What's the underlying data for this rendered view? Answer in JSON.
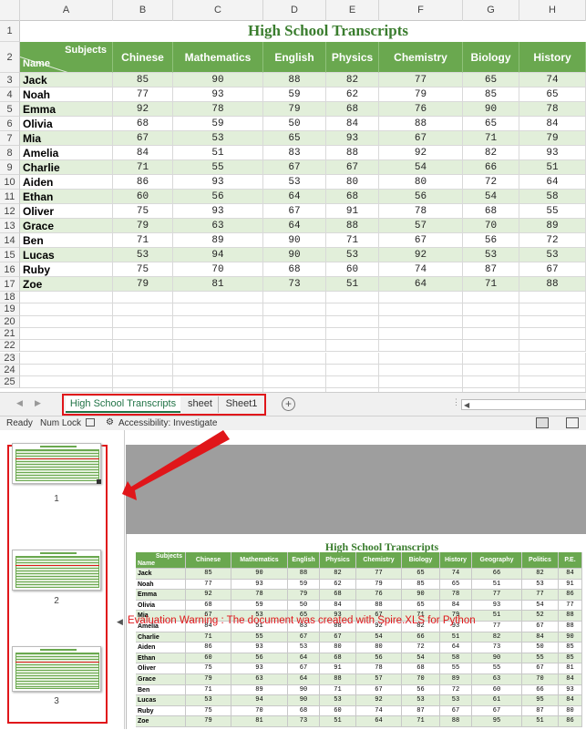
{
  "colors": {
    "accent": "#6aa84f",
    "band": "#e2efda",
    "title": "#3a7d2e",
    "annot": "#e0161a"
  },
  "sheet": {
    "column_letters": [
      "A",
      "B",
      "C",
      "D",
      "E",
      "F",
      "G",
      "H"
    ],
    "title": "High School Transcripts",
    "header_subjects_label": "Subjects",
    "header_name_label": "Name",
    "columns": [
      "Chinese",
      "Mathematics",
      "English",
      "Physics",
      "Chemistry",
      "Biology",
      "History"
    ],
    "rows": [
      {
        "name": "Jack",
        "values": [
          85,
          90,
          88,
          82,
          77,
          65,
          74
        ]
      },
      {
        "name": "Noah",
        "values": [
          77,
          93,
          59,
          62,
          79,
          85,
          65
        ]
      },
      {
        "name": "Emma",
        "values": [
          92,
          78,
          79,
          68,
          76,
          90,
          78
        ]
      },
      {
        "name": "Olivia",
        "values": [
          68,
          59,
          50,
          84,
          88,
          65,
          84
        ]
      },
      {
        "name": "Mia",
        "values": [
          67,
          53,
          65,
          93,
          67,
          71,
          79
        ]
      },
      {
        "name": "Amelia",
        "values": [
          84,
          51,
          83,
          88,
          92,
          82,
          93
        ]
      },
      {
        "name": "Charlie",
        "values": [
          71,
          55,
          67,
          67,
          54,
          66,
          51
        ]
      },
      {
        "name": "Aiden",
        "values": [
          86,
          93,
          53,
          80,
          80,
          72,
          64
        ]
      },
      {
        "name": "Ethan",
        "values": [
          60,
          56,
          64,
          68,
          56,
          54,
          58
        ]
      },
      {
        "name": "Oliver",
        "values": [
          75,
          93,
          67,
          91,
          78,
          68,
          55
        ]
      },
      {
        "name": "Grace",
        "values": [
          79,
          63,
          64,
          88,
          57,
          70,
          89
        ]
      },
      {
        "name": "Ben",
        "values": [
          71,
          89,
          90,
          71,
          67,
          56,
          72
        ]
      },
      {
        "name": "Lucas",
        "values": [
          53,
          94,
          90,
          53,
          92,
          53,
          53
        ]
      },
      {
        "name": "Ruby",
        "values": [
          75,
          70,
          68,
          60,
          74,
          87,
          67
        ]
      },
      {
        "name": "Zoe",
        "values": [
          79,
          81,
          73,
          51,
          64,
          71,
          88
        ]
      }
    ],
    "row_numbers": [
      "1",
      "2",
      "3",
      "4",
      "5",
      "6",
      "7",
      "8",
      "9",
      "10",
      "11",
      "12",
      "13",
      "14",
      "15",
      "16",
      "17",
      "18",
      "19",
      "20",
      "21",
      "22",
      "23",
      "24",
      "25",
      "26"
    ]
  },
  "tabs": {
    "items": [
      "High School Transcripts",
      "sheet",
      "Sheet1"
    ],
    "active_index": 0,
    "add_symbol": "+"
  },
  "status": {
    "ready": "Ready",
    "numlock": "Num Lock",
    "accessibility": "Accessibility: Investigate"
  },
  "preview": {
    "page_numbers": [
      "1",
      "2",
      "3"
    ],
    "title": "High School Transcripts",
    "extra_columns": [
      "Geography",
      "Politics",
      "P.E."
    ],
    "extra_values": [
      [
        66,
        82,
        84
      ],
      [
        51,
        53,
        91
      ],
      [
        77,
        77,
        86
      ],
      [
        93,
        54,
        77
      ],
      [
        51,
        52,
        88
      ],
      [
        77,
        67,
        88
      ],
      [
        82,
        84,
        90
      ],
      [
        73,
        50,
        85
      ],
      [
        90,
        55,
        85
      ],
      [
        55,
        67,
        81
      ],
      [
        63,
        70,
        84
      ],
      [
        60,
        66,
        93
      ],
      [
        61,
        95,
        84
      ],
      [
        67,
        87,
        80
      ],
      [
        95,
        51,
        86
      ]
    ],
    "warning": "Evaluation Warning : The document was created with  Spire.XLS for Python"
  }
}
